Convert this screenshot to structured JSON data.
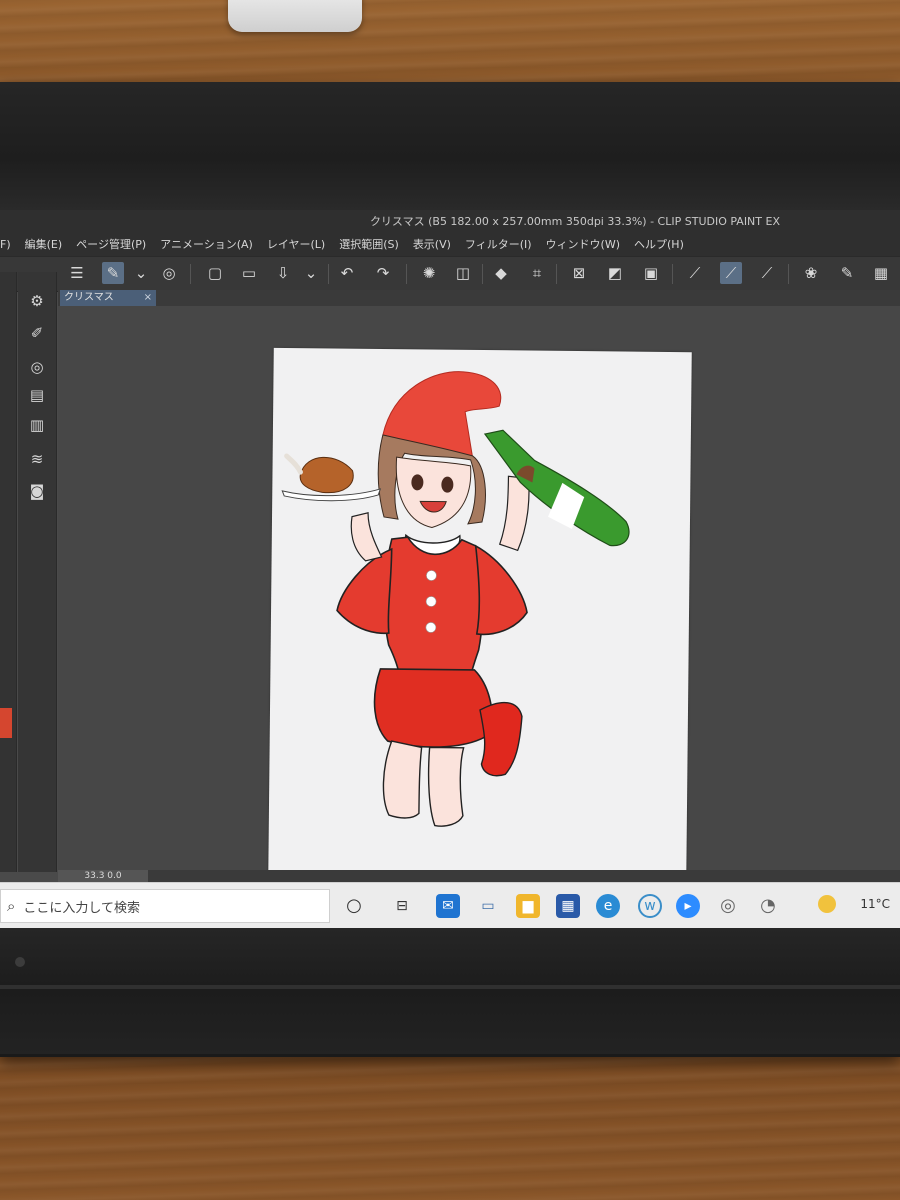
{
  "window": {
    "title": "クリスマス (B5 182.00 x 257.00mm 350dpi 33.3%)  - CLIP STUDIO PAINT EX"
  },
  "menu": {
    "items": [
      "F)",
      "編集(E)",
      "ページ管理(P)",
      "アニメーション(A)",
      "レイヤー(L)",
      "選択範囲(S)",
      "表示(V)",
      "フィルター(I)",
      "ウィンドウ(W)",
      "ヘルプ(H)"
    ]
  },
  "tab": {
    "name": "クリスマス"
  },
  "status": {
    "zoom": "33.3",
    "rotation": "0.0"
  },
  "taskbar": {
    "search_placeholder": "ここに入力して検索",
    "temperature": "11°C"
  },
  "colors": {
    "current_color": "#d5462f",
    "canvas_bg": "#474747",
    "taskbar_bg": "#ececec",
    "accent": "#5b6f86"
  },
  "icons": {
    "toolbar": [
      "menu-icon",
      "pen-cursor-icon",
      "chevron-down-icon",
      "clip-studio-icon",
      "new-file-icon",
      "open-folder-icon",
      "save-icon",
      "undo-icon",
      "redo-icon",
      "loading-icon",
      "transform-icon",
      "fill-icon",
      "crop-icon",
      "ruler-icon",
      "correction-icon",
      "stabilize-icon",
      "brush-icon",
      "vector-icon",
      "pen-icon",
      "checker-icon"
    ],
    "taskbar": [
      "cortana-icon",
      "task-view-icon",
      "mail-icon",
      "pc-icon",
      "file-explorer-icon",
      "store-icon",
      "edge-icon",
      "app-w-icon",
      "zoom-icon",
      "clip-studio-icon",
      "clip-studio-paint-icon"
    ]
  }
}
